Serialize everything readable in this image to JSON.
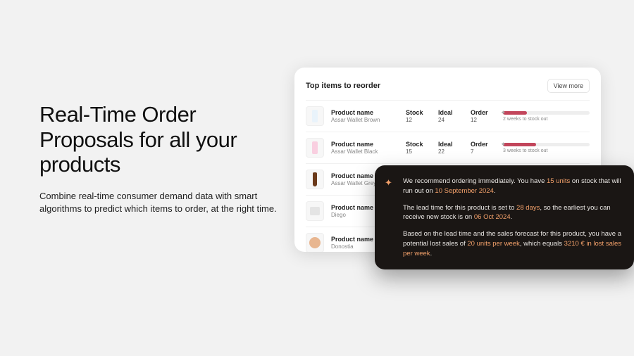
{
  "hero": {
    "headline": "Real-Time Order Proposals for all your products",
    "subcopy": "Combine real-time consumer demand data with smart algorithms to predict which items to order, at the right time."
  },
  "card": {
    "title": "Top items to reorder",
    "view_more": "View more",
    "columns": {
      "product": "Product name",
      "stock": "Stock",
      "ideal": "Ideal",
      "order": "Order"
    },
    "rows": [
      {
        "name": "Assar Wallet Brown",
        "stock": "12",
        "ideal": "24",
        "order": "12",
        "bar_pct": 28,
        "bar_caption": "2 weeks to stock out",
        "thumb_color": "#e9f3fb"
      },
      {
        "name": "Assar Wallet Black",
        "stock": "15",
        "ideal": "22",
        "order": "7",
        "bar_pct": 38,
        "bar_caption": "3 weeks to stock out",
        "thumb_color": "#f9cfe0"
      },
      {
        "name": "Assar Wallet Grey",
        "stock": "",
        "ideal": "",
        "order": "",
        "bar_pct": 0,
        "bar_caption": "",
        "thumb_type": "bottle"
      },
      {
        "name": "Diego",
        "stock": "",
        "ideal": "",
        "order": "",
        "bar_pct": 0,
        "bar_caption": "",
        "thumb_type": "box"
      },
      {
        "name": "Donostia",
        "stock": "",
        "ideal": "",
        "order": "",
        "bar_pct": 0,
        "bar_caption": "",
        "thumb_type": "circle"
      }
    ]
  },
  "tooltip": {
    "p1_a": "We recommend ordering immediately. You have ",
    "p1_units": "15 units",
    "p1_b": " on stock that will run out on ",
    "p1_date": "10 September 2024",
    "p1_c": ".",
    "p2_a": "The lead time for this product is set to ",
    "p2_days": "28 days",
    "p2_b": ", so the earliest you can receive new stock is on ",
    "p2_date": "06 Oct 2024",
    "p2_c": ".",
    "p3_a": "Based on the lead time and the sales forecast for this product, you have a potential lost sales of ",
    "p3_units": "20 units per week",
    "p3_b": ", which equals ",
    "p3_amount": "3210 € in lost sales per week",
    "p3_c": "."
  }
}
